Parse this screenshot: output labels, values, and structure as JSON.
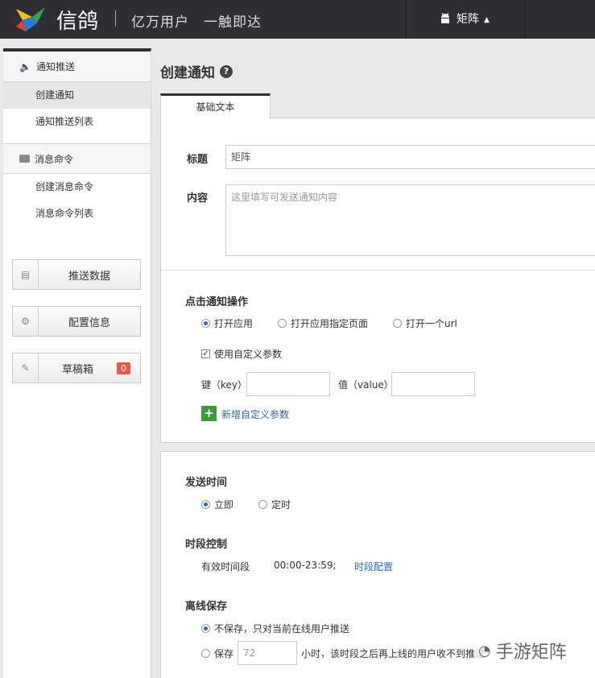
{
  "header": {
    "brand": "信鸽",
    "slogan": "亿万用户　一触即达",
    "user": "矩阵"
  },
  "sidebar": {
    "push_section": "通知推送",
    "push_items": [
      "创建通知",
      "通知推送列表"
    ],
    "msg_section": "消息命令",
    "msg_items": [
      "创建消息命令",
      "消息命令列表"
    ],
    "buttons": {
      "push_data": "推送数据",
      "config": "配置信息",
      "drafts": "草稿箱",
      "drafts_count": "0"
    }
  },
  "main": {
    "title": "创建通知",
    "help": "?",
    "tab": "基础文本",
    "form": {
      "title_label": "标题",
      "title_value": "矩阵",
      "content_label": "内容",
      "content_placeholder": "这里填写可发送通知内容"
    },
    "click_action": {
      "label": "点击通知操作",
      "options": [
        "打开应用",
        "打开应用指定页面",
        "打开一个url"
      ],
      "selected": 0,
      "custom_param_label": "使用自定义参数",
      "key_label": "键（key）",
      "value_label": "值（value）",
      "add_param": "新增自定义参数"
    },
    "send_time": {
      "label": "发送时间",
      "options": [
        "立即",
        "定时"
      ]
    },
    "period": {
      "label": "时段控制",
      "valid_label": "有效时间段",
      "valid_value": "00:00-23:59;",
      "config_link": "时段配置"
    },
    "offline": {
      "label": "离线保存",
      "no_save": "不保存，只对当前在线用户推送",
      "save": "保存",
      "hours_placeholder": "72",
      "hours_suffix": "小时，该时段之后再上线的用户收不到推送"
    }
  },
  "watermark": "手游矩阵",
  "colors": {
    "topbar": "#2d2f35",
    "accent": "#2a6ab8",
    "badge": "#e05b49",
    "add": "#3c9a3c"
  }
}
